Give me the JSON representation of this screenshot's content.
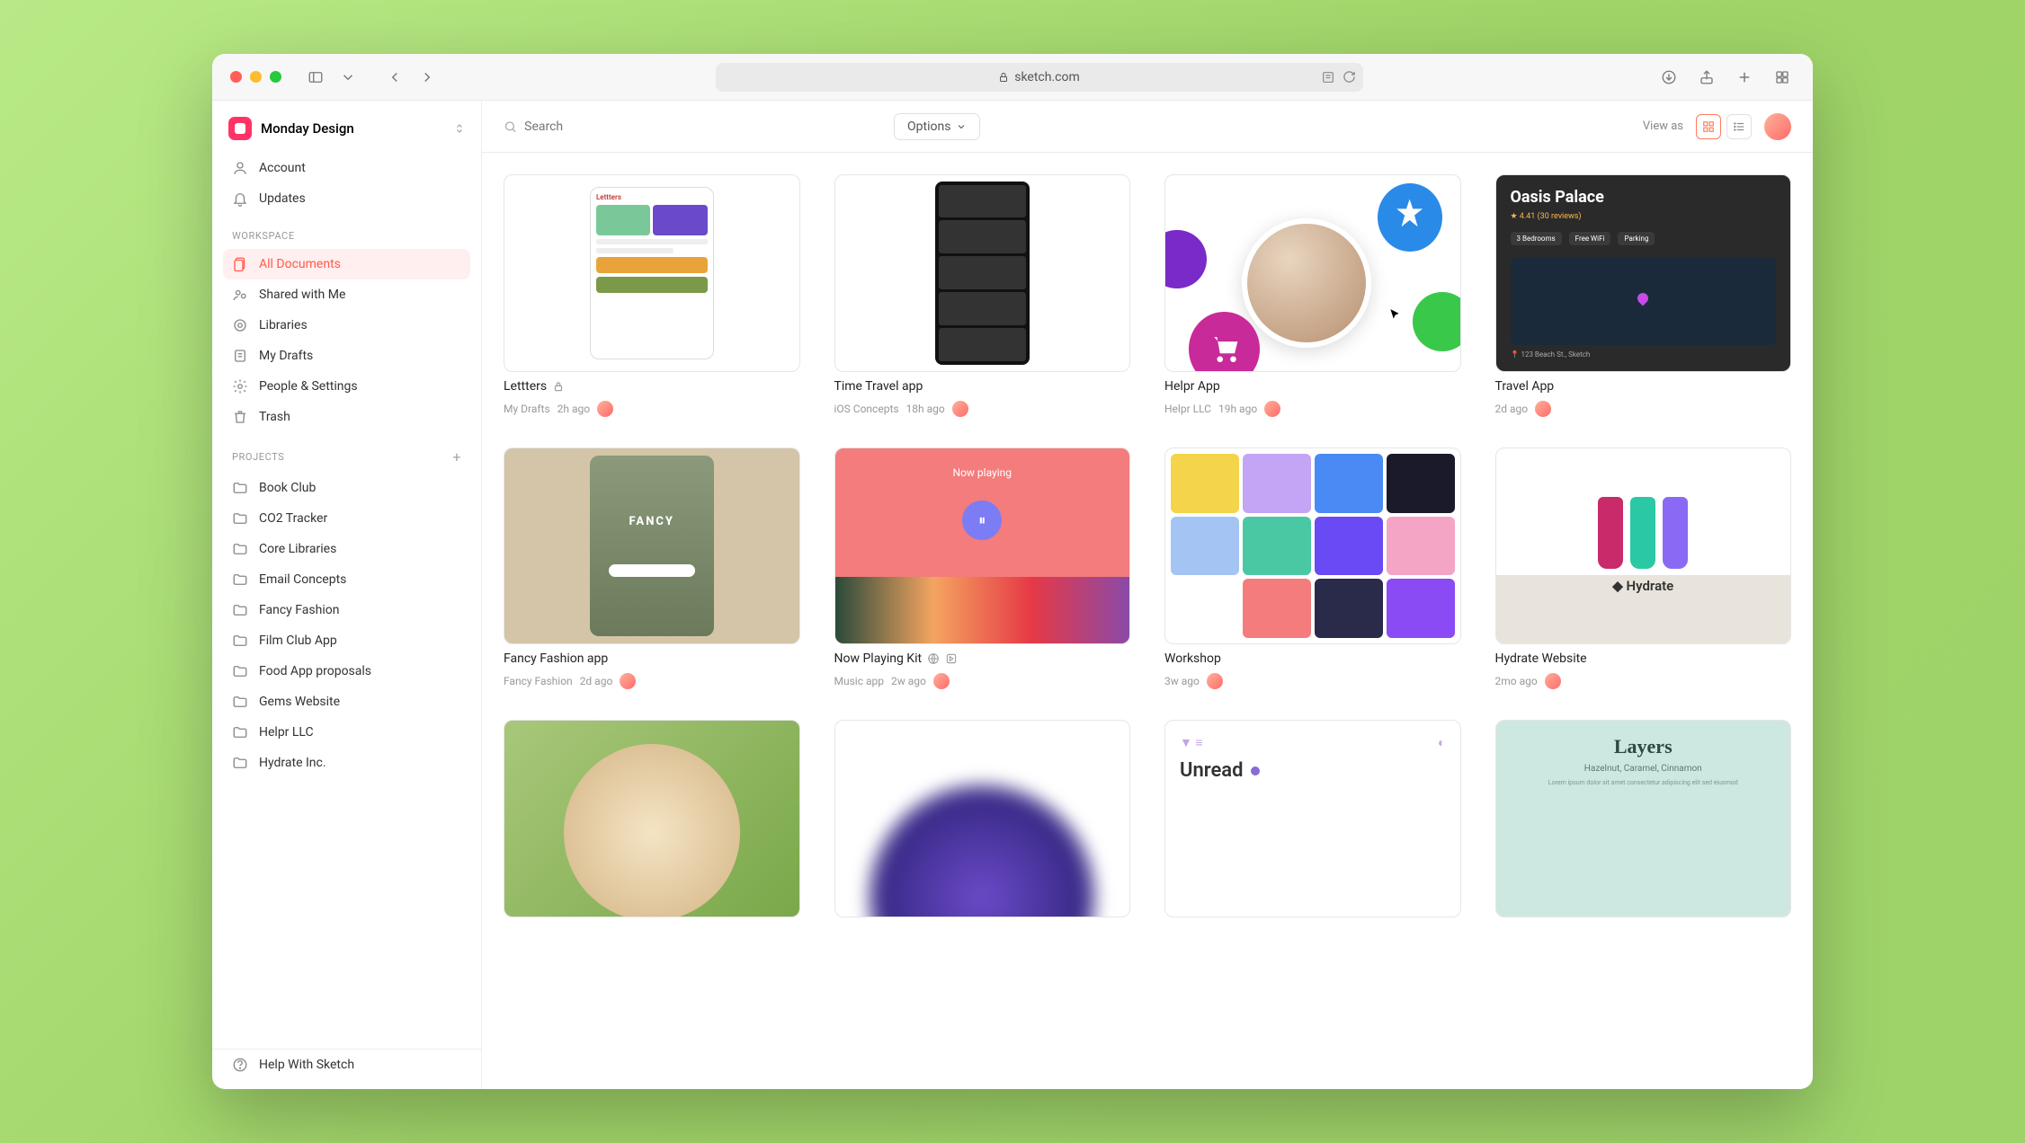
{
  "browser": {
    "url": "sketch.com"
  },
  "workspace": {
    "name": "Monday Design"
  },
  "sidebar": {
    "top": [
      {
        "icon": "user",
        "label": "Account"
      },
      {
        "icon": "bell",
        "label": "Updates"
      }
    ],
    "workspace_label": "WORKSPACE",
    "workspace_items": [
      {
        "icon": "docs",
        "label": "All Documents",
        "active": true
      },
      {
        "icon": "shared",
        "label": "Shared with Me"
      },
      {
        "icon": "lib",
        "label": "Libraries"
      },
      {
        "icon": "draft",
        "label": "My Drafts"
      },
      {
        "icon": "gear",
        "label": "People & Settings"
      },
      {
        "icon": "trash",
        "label": "Trash"
      }
    ],
    "projects_label": "PROJECTS",
    "projects": [
      {
        "label": "Book Club"
      },
      {
        "label": "CO2 Tracker"
      },
      {
        "label": "Core Libraries"
      },
      {
        "label": "Email Concepts"
      },
      {
        "label": "Fancy Fashion"
      },
      {
        "label": "Film Club App"
      },
      {
        "label": "Food App proposals"
      },
      {
        "label": "Gems Website"
      },
      {
        "label": "Helpr LLC"
      },
      {
        "label": "Hydrate Inc."
      }
    ],
    "help_label": "Help With Sketch"
  },
  "toolbar": {
    "search_placeholder": "Search",
    "options_label": "Options",
    "view_as_label": "View as"
  },
  "documents": [
    {
      "title": "Lettters",
      "locked": true,
      "folder": "My Drafts",
      "time": "2h ago",
      "thumb": "letters"
    },
    {
      "title": "Time Travel app",
      "folder": "iOS Concepts",
      "time": "18h ago",
      "thumb": "timetravel"
    },
    {
      "title": "Helpr App",
      "folder": "Helpr LLC",
      "time": "19h ago",
      "thumb": "helpr"
    },
    {
      "title": "Travel App",
      "folder": "",
      "time": "2d ago",
      "thumb": "travel"
    },
    {
      "title": "Fancy Fashion app",
      "folder": "Fancy Fashion",
      "time": "2d ago",
      "thumb": "fancy"
    },
    {
      "title": "Now Playing Kit",
      "badges": true,
      "folder": "Music app",
      "time": "2w ago",
      "thumb": "nowplaying"
    },
    {
      "title": "Workshop",
      "folder": "",
      "time": "3w ago",
      "thumb": "workshop"
    },
    {
      "title": "Hydrate Website",
      "folder": "",
      "time": "2mo ago",
      "thumb": "hydrate"
    },
    {
      "title": "",
      "folder": "",
      "time": "",
      "thumb": "food"
    },
    {
      "title": "",
      "folder": "",
      "time": "",
      "thumb": "purple"
    },
    {
      "title": "",
      "folder": "",
      "time": "",
      "thumb": "unread"
    },
    {
      "title": "",
      "folder": "",
      "time": "",
      "thumb": "layers"
    }
  ],
  "thumbs": {
    "letters_header": "Lettters",
    "travel_title": "Oasis Palace",
    "travel_stars": "★ 4.41 (30 reviews)",
    "travel_pill1": "3 Bedrooms",
    "travel_pill2": "Free WiFi",
    "travel_pill3": "Parking",
    "travel_addr": "123 Beach St., Sketch",
    "fancy_label": "FANCY",
    "nowplaying_label": "Now playing",
    "hydrate_brand": "Hydrate",
    "unread_title": "Unread",
    "layers_title": "Layers",
    "layers_sub": "Hazelnut, Caramel, Cinnamon"
  }
}
